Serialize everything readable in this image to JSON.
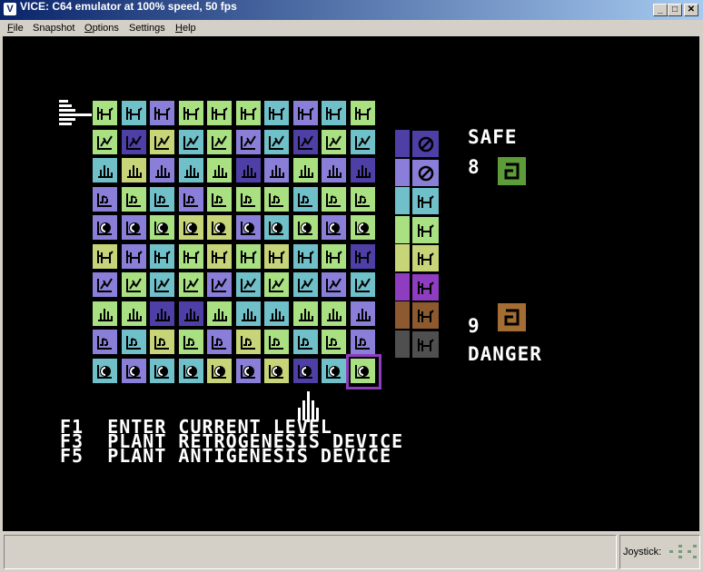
{
  "window": {
    "title": "VICE: C64 emulator at 100% speed, 50 fps",
    "app_icon": "vice-icon",
    "app_icon_glyph": "V",
    "controls": [
      "minimize-icon",
      "maximize-icon",
      "close-icon"
    ]
  },
  "menu": [
    {
      "hotkey": "F",
      "rest": "ile"
    },
    {
      "hotkey": "",
      "rest": "Snapshot"
    },
    {
      "hotkey": "O",
      "rest": "ptions"
    },
    {
      "hotkey": "",
      "rest": "Settings"
    },
    {
      "hotkey": "H",
      "rest": "elp"
    }
  ],
  "palette": {
    "lightgreen": "#a9e082",
    "cyan": "#6fc0c9",
    "blue": "#4d3fa6",
    "lightblue": "#8a7fd8",
    "yellow": "#c8d478",
    "purple": "#8e3cc0",
    "brown": "#8c5a2e",
    "darkgrey": "#4f4f4f",
    "green": "#5e9c3a",
    "orange": "#a46d33"
  },
  "game": {
    "icon_rows": [
      "cat",
      "bird",
      "plant",
      "note",
      "eye",
      "cat",
      "bird",
      "plant",
      "note",
      "eye"
    ],
    "grid_colors": [
      [
        "lightgreen",
        "cyan",
        "lightblue",
        "lightgreen",
        "lightgreen",
        "lightgreen",
        "cyan",
        "lightblue",
        "cyan",
        "lightgreen"
      ],
      [
        "lightgreen",
        "blue",
        "yellow",
        "cyan",
        "lightgreen",
        "lightblue",
        "cyan",
        "blue",
        "lightgreen",
        "cyan"
      ],
      [
        "cyan",
        "yellow",
        "lightblue",
        "cyan",
        "lightgreen",
        "blue",
        "lightblue",
        "lightgreen",
        "lightblue",
        "blue"
      ],
      [
        "lightblue",
        "lightgreen",
        "cyan",
        "lightblue",
        "lightgreen",
        "lightgreen",
        "lightgreen",
        "cyan",
        "lightgreen",
        "lightgreen"
      ],
      [
        "lightblue",
        "lightblue",
        "lightgreen",
        "yellow",
        "yellow",
        "lightblue",
        "cyan",
        "lightgreen",
        "lightblue",
        "lightgreen"
      ],
      [
        "yellow",
        "lightblue",
        "cyan",
        "lightgreen",
        "yellow",
        "lightgreen",
        "yellow",
        "cyan",
        "lightgreen",
        "blue"
      ],
      [
        "lightblue",
        "lightgreen",
        "cyan",
        "lightgreen",
        "lightblue",
        "cyan",
        "lightgreen",
        "cyan",
        "lightblue",
        "cyan"
      ],
      [
        "lightgreen",
        "lightgreen",
        "blue",
        "blue",
        "lightgreen",
        "cyan",
        "cyan",
        "lightgreen",
        "lightgreen",
        "lightblue"
      ],
      [
        "lightblue",
        "cyan",
        "yellow",
        "lightgreen",
        "lightblue",
        "yellow",
        "lightgreen",
        "cyan",
        "lightgreen",
        "lightblue"
      ],
      [
        "cyan",
        "lightblue",
        "cyan",
        "cyan",
        "yellow",
        "lightblue",
        "yellow",
        "blue",
        "cyan",
        "lightgreen"
      ]
    ],
    "cursor": {
      "row": 9,
      "col": 9,
      "color": "purple"
    },
    "legend": [
      {
        "color": "blue",
        "icon": "no-entry"
      },
      {
        "color": "lightblue",
        "icon": "no-entry"
      },
      {
        "color": "cyan",
        "icon": "cat"
      },
      {
        "color": "lightgreen",
        "icon": "cat"
      },
      {
        "color": "yellow",
        "icon": "cat"
      },
      {
        "color": "purple",
        "icon": "cat"
      },
      {
        "color": "brown",
        "icon": "cat"
      },
      {
        "color": "darkgrey",
        "icon": "cat"
      }
    ],
    "safe_label": "SAFE",
    "safe_count": "8",
    "safe_icon_color": "green",
    "danger_label": "DANGER",
    "danger_count": "9",
    "danger_icon_color": "orange",
    "menu_lines": [
      {
        "key": "F1",
        "text": "ENTER CURRENT LEVEL"
      },
      {
        "key": "F3",
        "text": "PLANT RETROGENESIS DEVICE"
      },
      {
        "key": "F5",
        "text": "PLANT ANTIGENESIS DEVICE"
      }
    ]
  },
  "status": {
    "joystick_label": "Joystick:",
    "joystick_icon": "joystick-indicator-icon"
  }
}
